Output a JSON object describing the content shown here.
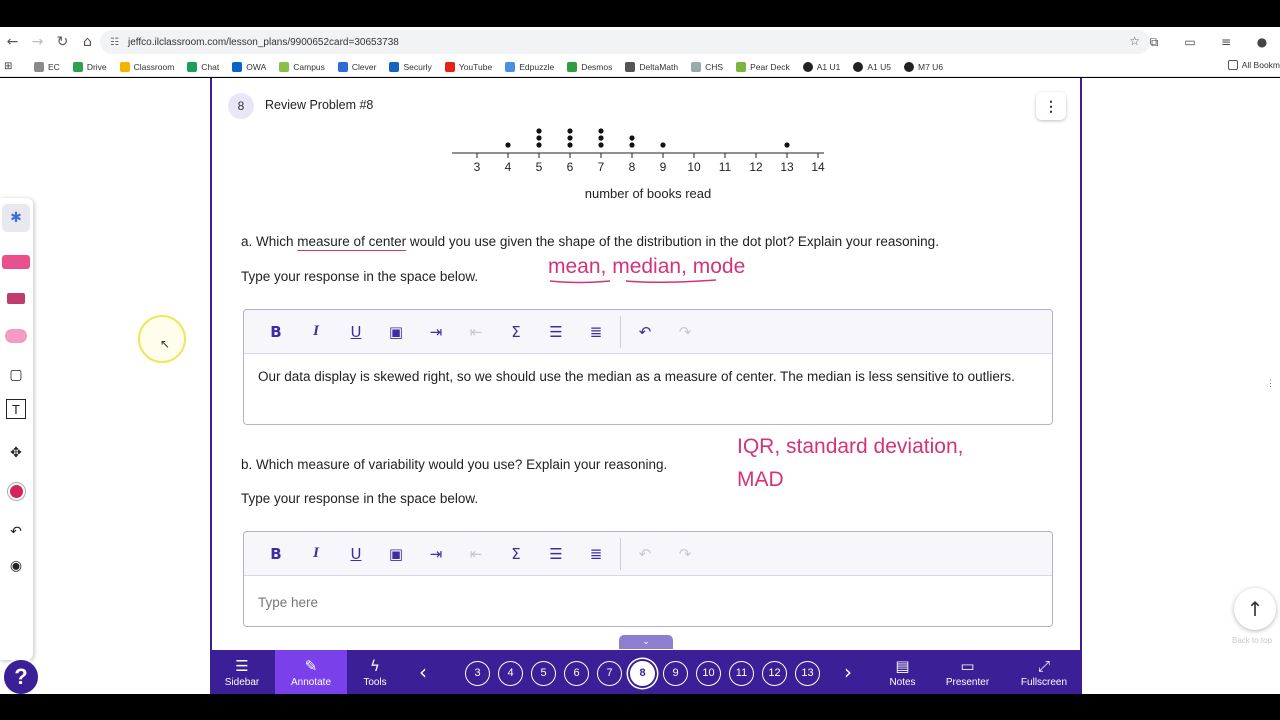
{
  "browser": {
    "url": "jeffco.ilclassroom.com/lesson_plans/9900652card=30653738",
    "bookmarks": [
      "EC",
      "Drive",
      "Classroom",
      "Chat",
      "OWA",
      "Campus",
      "Clever",
      "Securly",
      "YouTube",
      "Edpuzzle",
      "Desmos",
      "DeltaMath",
      "CHS",
      "Pear Deck",
      "A1 U1",
      "A1 U5",
      "M7 U6"
    ],
    "all_bookmarks": "All Bookm"
  },
  "card": {
    "number": "8",
    "title": "Review Problem #8"
  },
  "chart_data": {
    "type": "scatter",
    "xlabel": "number of books read",
    "ticks": [
      "3",
      "4",
      "5",
      "6",
      "7",
      "8",
      "9",
      "10",
      "11",
      "12",
      "13",
      "14"
    ],
    "xlim": [
      3,
      14
    ],
    "dots": [
      {
        "x": 4,
        "count": 1
      },
      {
        "x": 5,
        "count": 3
      },
      {
        "x": 6,
        "count": 3
      },
      {
        "x": 7,
        "count": 3
      },
      {
        "x": 8,
        "count": 2
      },
      {
        "x": 9,
        "count": 1
      },
      {
        "x": 13,
        "count": 1
      }
    ]
  },
  "question_a": {
    "prefix": "a. Which ",
    "underlined": "measure of center",
    "suffix": " would you use given the shape of the distribution in the dot plot? Explain your reasoning.",
    "instruction": "Type your response in the space below.",
    "annotation": "mean, median, mode",
    "response": "Our data display is skewed right, so we should use the median as a measure of center. The median is less sensitive to outliers."
  },
  "question_b": {
    "text": "b. Which measure of variability would you use? Explain your reasoning.",
    "instruction": "Type your response in the space below.",
    "annotation_line1": "IQR, standard deviation,",
    "annotation_line2": "MAD",
    "placeholder": "Type here"
  },
  "bottom_nav": {
    "sidebar": "Sidebar",
    "annotate": "Annotate",
    "tools": "Tools",
    "pages": [
      "3",
      "4",
      "5",
      "6",
      "7",
      "8",
      "9",
      "10",
      "11",
      "12",
      "13"
    ],
    "current_page": "8",
    "notes": "Notes",
    "presenter": "Presenter",
    "fullscreen": "Fullscreen"
  },
  "misc": {
    "help": "?",
    "back_to_top": "Back to top"
  },
  "colors": {
    "brand": "#3a1f96",
    "active": "#7a40ea",
    "ink": "#d4337a"
  }
}
